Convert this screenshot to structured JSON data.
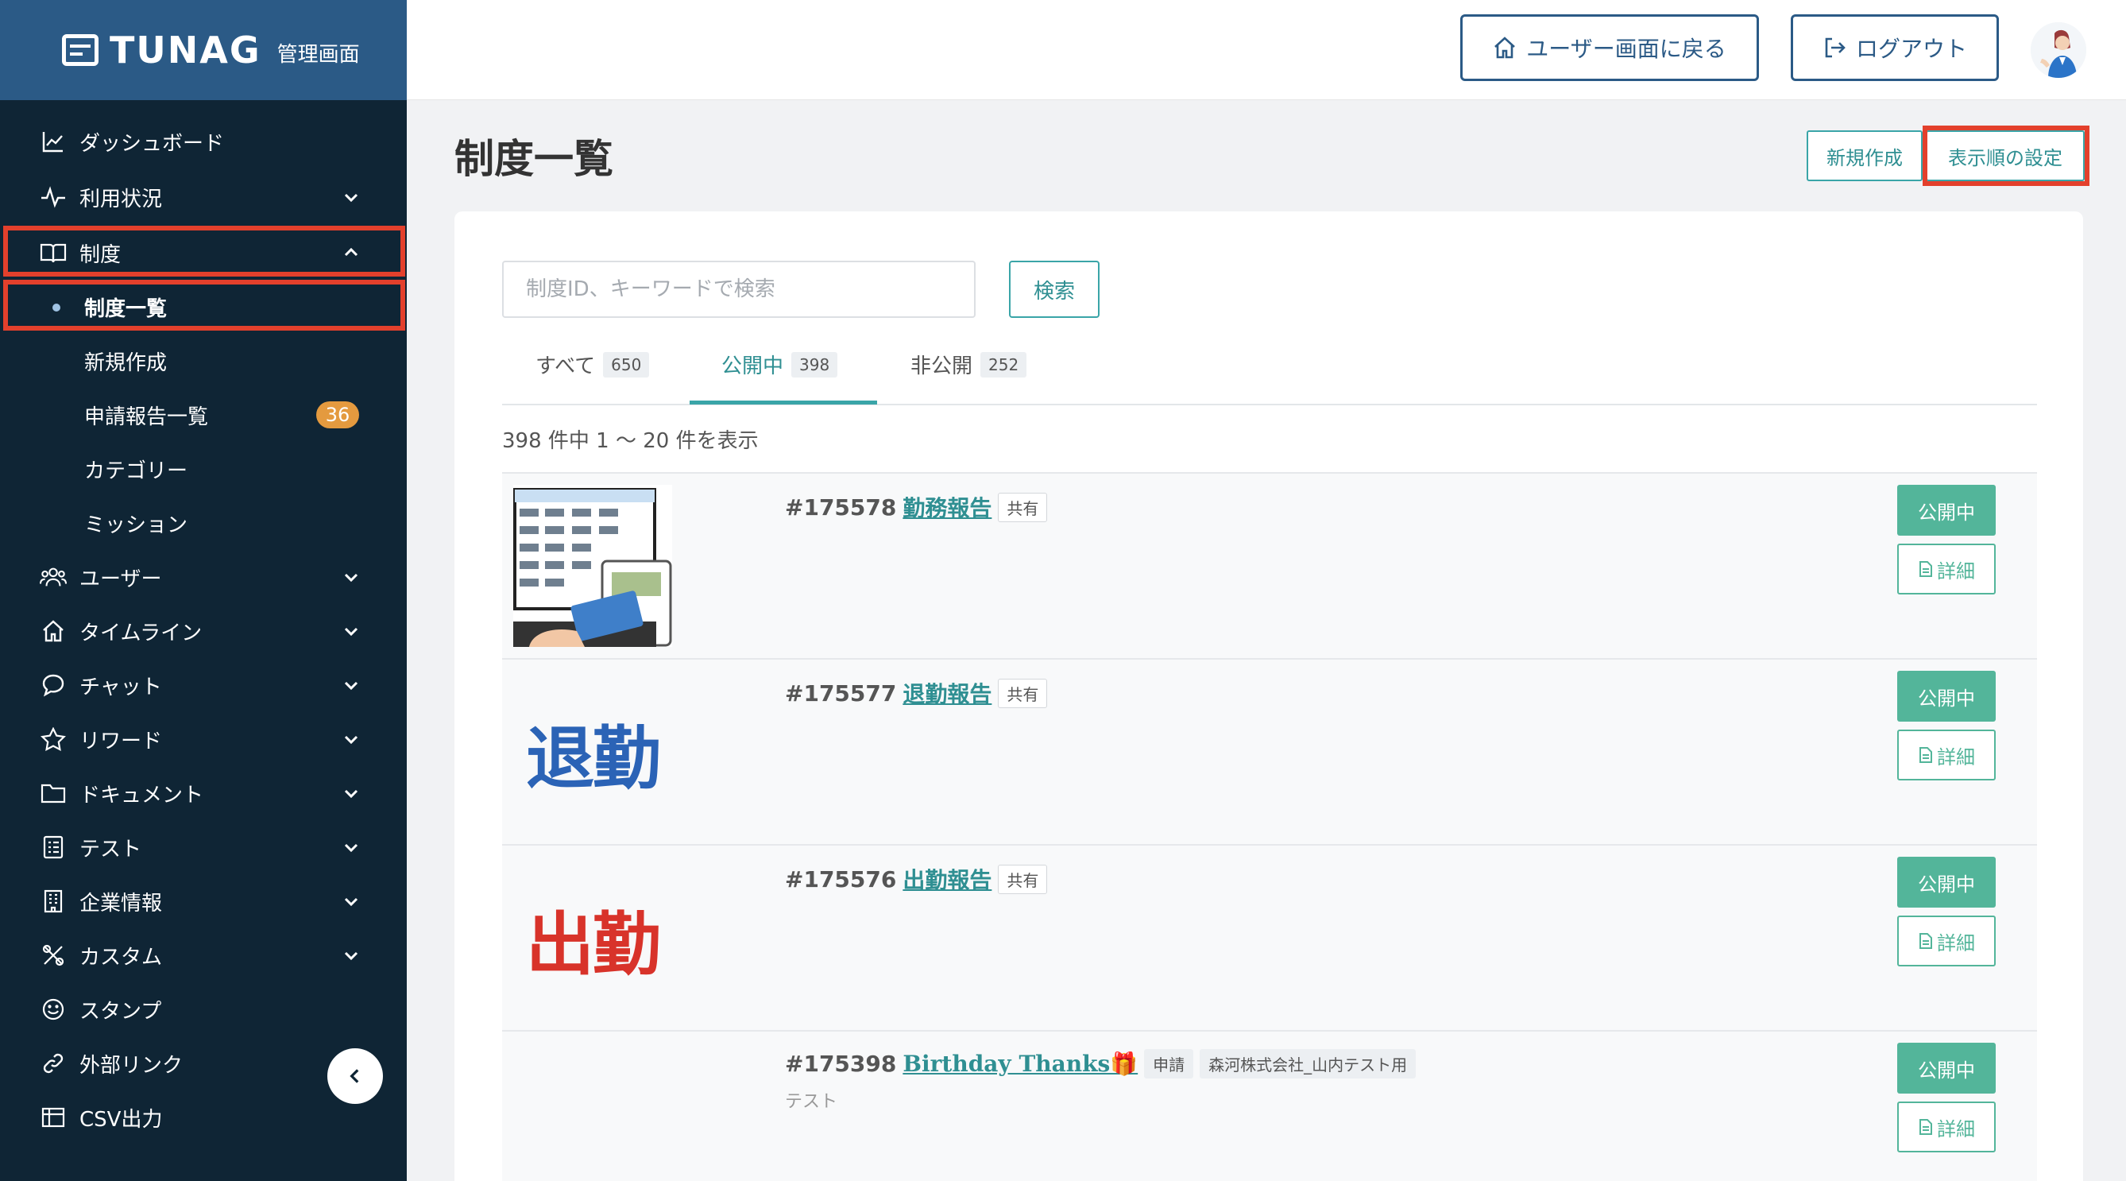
{
  "brand": {
    "name": "TUNAG",
    "subtitle": "管理画面"
  },
  "sidebar": {
    "items": [
      {
        "label": "ダッシュボード",
        "icon": "chart-line-icon"
      },
      {
        "label": "利用状況",
        "icon": "activity-icon"
      },
      {
        "label": "制度",
        "icon": "book-icon"
      },
      {
        "label": "ユーザー",
        "icon": "users-icon"
      },
      {
        "label": "タイムライン",
        "icon": "home-icon"
      },
      {
        "label": "チャット",
        "icon": "chat-bubble-icon"
      },
      {
        "label": "リワード",
        "icon": "star-icon"
      },
      {
        "label": "ドキュメント",
        "icon": "folder-icon"
      },
      {
        "label": "テスト",
        "icon": "checklist-icon"
      },
      {
        "label": "企業情報",
        "icon": "building-icon"
      },
      {
        "label": "カスタム",
        "icon": "tools-icon"
      },
      {
        "label": "スタンプ",
        "icon": "smile-icon"
      },
      {
        "label": "外部リンク",
        "icon": "link-icon"
      },
      {
        "label": "CSV出力",
        "icon": "table-icon"
      }
    ],
    "sub_items": [
      {
        "label": "制度一覧"
      },
      {
        "label": "新規作成"
      },
      {
        "label": "申請報告一覧",
        "badge": "36"
      },
      {
        "label": "カテゴリー"
      },
      {
        "label": "ミッション"
      }
    ]
  },
  "topbar": {
    "back_label": "ユーザー画面に戻る",
    "logout_label": "ログアウト"
  },
  "page": {
    "title": "制度一覧",
    "new_label": "新規作成",
    "order_label": "表示順の設定"
  },
  "search": {
    "placeholder": "制度ID、キーワードで検索",
    "button_label": "検索"
  },
  "tabs": [
    {
      "label": "すべて",
      "count": "650"
    },
    {
      "label": "公開中",
      "count": "398"
    },
    {
      "label": "非公開",
      "count": "252"
    }
  ],
  "result_count": "398 件中 1 〜 20 件を表示",
  "rows": [
    {
      "id": "#175578",
      "name": "勤務報告",
      "tags": [
        "共有"
      ],
      "desc": "",
      "status": "公開中",
      "detail": "詳細",
      "thumb_text": ""
    },
    {
      "id": "#175577",
      "name": "退勤報告",
      "tags": [
        "共有"
      ],
      "desc": "",
      "status": "公開中",
      "detail": "詳細",
      "thumb_text": "退勤"
    },
    {
      "id": "#175576",
      "name": "出勤報告",
      "tags": [
        "共有"
      ],
      "desc": "",
      "status": "公開中",
      "detail": "詳細",
      "thumb_text": "出勤"
    },
    {
      "id": "#175398",
      "name": "Birthday Thanks🎁",
      "tags": [
        "申請",
        "森河株式会社_山内テスト用"
      ],
      "desc": "テスト",
      "status": "公開中",
      "detail": "詳細",
      "thumb_text": ""
    }
  ],
  "colors": {
    "sidebar_bg": "#0f2535",
    "brand_bg": "#2b5a86",
    "accent_teal": "#3aa5a8",
    "status_green": "#53b59a",
    "highlight_red": "#e3402c",
    "badge_orange": "#e49a3f"
  }
}
